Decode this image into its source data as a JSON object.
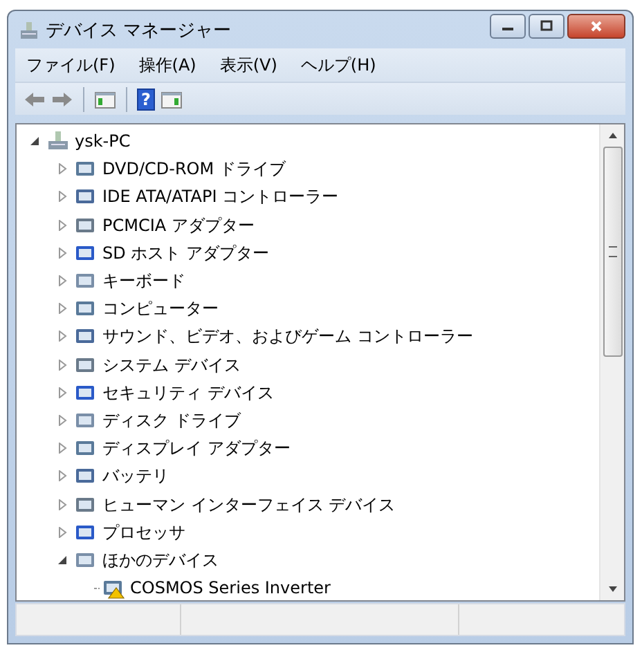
{
  "window": {
    "title": "デバイス マネージャー"
  },
  "menu": [
    "ファイル(F)",
    "操作(A)",
    "表示(V)",
    "ヘルプ(H)"
  ],
  "toolbar": {
    "back_disabled": false,
    "forward_disabled": false,
    "help_glyph": "?"
  },
  "tree": {
    "label": "ysk-PC",
    "expanded": true,
    "children": [
      {
        "label": "DVD/CD-ROM ドライブ",
        "expanded": false
      },
      {
        "label": "IDE ATA/ATAPI コントローラー",
        "expanded": false
      },
      {
        "label": "PCMCIA アダプター",
        "expanded": false
      },
      {
        "label": "SD ホスト アダプター",
        "expanded": false
      },
      {
        "label": "キーボード",
        "expanded": false
      },
      {
        "label": "コンピューター",
        "expanded": false
      },
      {
        "label": "サウンド、ビデオ、およびゲーム コントローラー",
        "expanded": false
      },
      {
        "label": "システム デバイス",
        "expanded": false
      },
      {
        "label": "セキュリティ デバイス",
        "expanded": false
      },
      {
        "label": "ディスク ドライブ",
        "expanded": false
      },
      {
        "label": "ディスプレイ アダプター",
        "expanded": false
      },
      {
        "label": "バッテリ",
        "expanded": false
      },
      {
        "label": "ヒューマン インターフェイス デバイス",
        "expanded": false
      },
      {
        "label": "プロセッサ",
        "expanded": false
      },
      {
        "label": "ほかのデバイス",
        "expanded": true,
        "children": [
          {
            "label": "COSMOS Series Inverter",
            "warning": true
          }
        ]
      }
    ]
  }
}
